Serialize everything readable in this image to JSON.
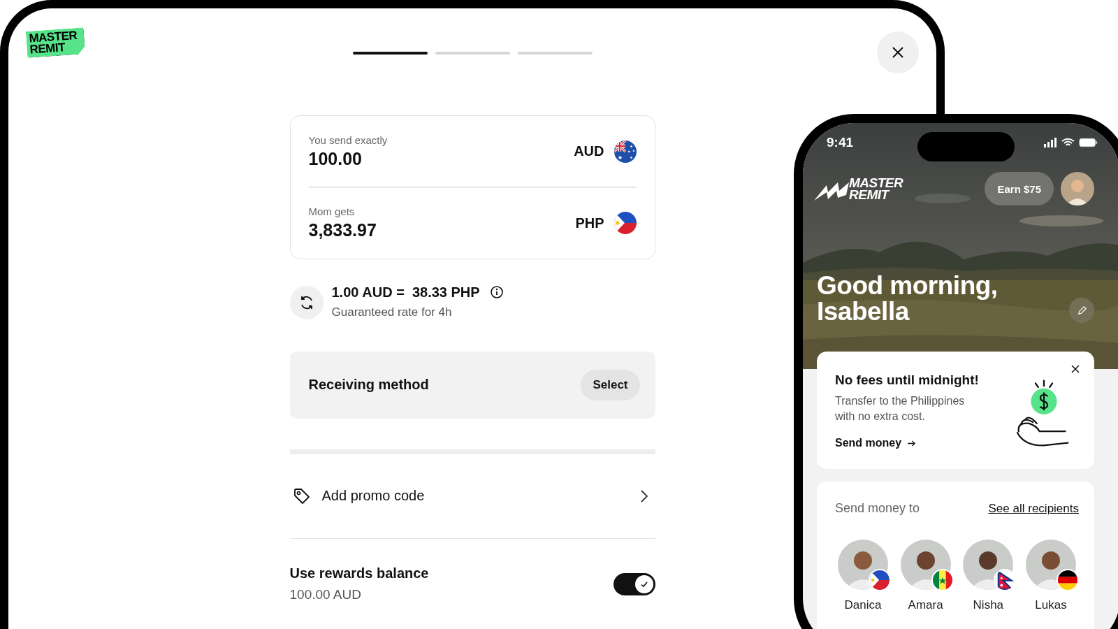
{
  "desktop": {
    "logo_lines": [
      "MASTER",
      "REMIT"
    ],
    "steps": [
      {
        "selected": true
      },
      {
        "selected": false
      },
      {
        "selected": false
      }
    ],
    "amounts": [
      {
        "label": "You send exactly",
        "value": "100.00",
        "currency": "AUD",
        "kind": "au"
      },
      {
        "label": "Mom gets",
        "value": "3,833.97",
        "currency": "PHP",
        "kind": "ph"
      }
    ],
    "rate": {
      "text": "1.00 AUD =  38.33 PHP",
      "note": "Guaranteed rate for 4h"
    },
    "receiving": {
      "label": "Receiving method",
      "button": "Select"
    },
    "promo": {
      "label": "Add promo code"
    },
    "rewards": {
      "label": "Use rewards balance",
      "value": "100.00 AUD",
      "on": true
    }
  },
  "phone": {
    "time": "9:41",
    "logo_lines": [
      "MASTER",
      "REMIT"
    ],
    "earn": "Earn $75",
    "greeting_lines": [
      "Good morning,",
      "Isabella"
    ],
    "offer": {
      "title": "No fees until midnight!",
      "text": "Transfer to the Philippines with no extra cost.",
      "link": "Send money"
    },
    "recipients": {
      "title": "Send money to",
      "link": "See all recipients",
      "people": [
        {
          "name": "Danica",
          "kind": "ph"
        },
        {
          "name": "Amara",
          "kind": "sn"
        },
        {
          "name": "Nisha",
          "kind": "np"
        },
        {
          "name": "Lukas",
          "kind": "de"
        }
      ]
    }
  }
}
